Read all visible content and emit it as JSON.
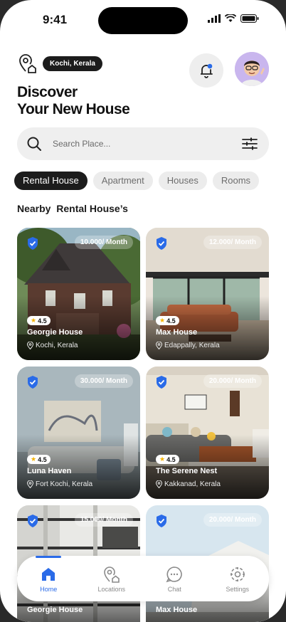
{
  "status": {
    "time": "9:41"
  },
  "header": {
    "location": "Kochi, Kerala",
    "title_line1": "Discover",
    "title_line2": "Your New House"
  },
  "search": {
    "placeholder": "Search Place..."
  },
  "filters": [
    {
      "label": "Rental House",
      "active": true
    },
    {
      "label": "Apartment",
      "active": false
    },
    {
      "label": "Houses",
      "active": false
    },
    {
      "label": "Rooms",
      "active": false
    }
  ],
  "section_title": "Nearby  Rental House’s",
  "listings": [
    {
      "price": "10.000/ Month",
      "rating": "4.5",
      "name": "Georgie House",
      "place": "Kochi, Kerala"
    },
    {
      "price": "12.000/ Month",
      "rating": "4.5",
      "name": "Max House",
      "place": "Edappally, Kerala"
    },
    {
      "price": "30.000/ Month",
      "rating": "4.5",
      "name": "Luna Haven",
      "place": "Fort Kochi, Kerala"
    },
    {
      "price": "20.000/ Month",
      "rating": "4.5",
      "name": "The Serene Nest",
      "place": "Kakkanad, Kerala"
    },
    {
      "price": "15.000/ Month",
      "rating": "",
      "name": "Georgie House",
      "place": ""
    },
    {
      "price": "20.000/ Month",
      "rating": "",
      "name": "Max House",
      "place": ""
    }
  ],
  "nav": [
    {
      "label": "Home",
      "icon": "home-icon",
      "active": true
    },
    {
      "label": "Locations",
      "icon": "location-house-icon",
      "active": false
    },
    {
      "label": "Chat",
      "icon": "chat-icon",
      "active": false
    },
    {
      "label": "Settings",
      "icon": "settings-icon",
      "active": false
    }
  ],
  "colors": {
    "accent": "#2a6be8",
    "dark": "#1c1c1c",
    "chip": "#ececec"
  }
}
